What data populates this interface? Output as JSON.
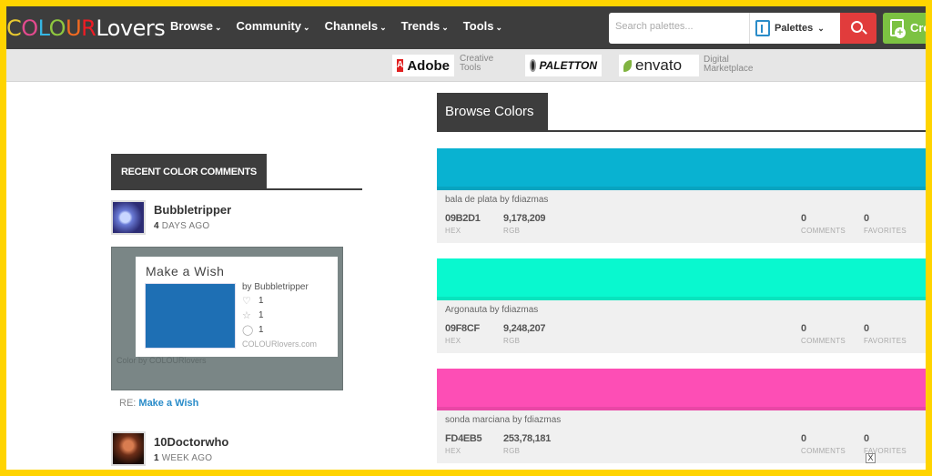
{
  "brand": {
    "logo_parts": [
      "C",
      "O",
      "L",
      "O",
      "U",
      "R"
    ],
    "logo_suffix": "Lovers"
  },
  "nav": {
    "items": [
      {
        "label": "Browse"
      },
      {
        "label": "Community"
      },
      {
        "label": "Channels"
      },
      {
        "label": "Trends"
      },
      {
        "label": "Tools"
      }
    ],
    "search_placeholder": "Search palettes...",
    "search_scope": "Palettes",
    "create_label": "Cre"
  },
  "sponsors": {
    "adobe": {
      "name": "Adobe",
      "mark": "A",
      "desc_line1": "Creative",
      "desc_line2": "Tools"
    },
    "paletton": {
      "name": "PALETTON"
    },
    "envato": {
      "name": "envato",
      "desc_line1": "Digital",
      "desc_line2": "Marketplace"
    }
  },
  "comments": {
    "heading": "RECENT COLOR COMMENTS",
    "items": [
      {
        "user": "Bubbletripper",
        "time_num": "4",
        "time_unit": "DAYS AGO"
      },
      {
        "user": "10Doctorwho",
        "time_num": "1",
        "time_unit": "WEEK AGO"
      }
    ],
    "card": {
      "title": "Make a Wish",
      "by": "by Bubbletripper",
      "swatch_color": "#1e6fb4",
      "loves": "1",
      "favorites": "1",
      "comments": "1",
      "site": "COLOURlovers.com",
      "credit": "Color by COLOURlovers"
    },
    "re_prefix": "RE:",
    "re_link": "Make a Wish"
  },
  "browse": {
    "heading": "Browse Colors",
    "hex_label": "HEX",
    "rgb_label": "RGB",
    "comments_label": "COMMENTS",
    "favorites_label": "FAVORITES",
    "colors": [
      {
        "name": "bala de plata",
        "by": "by fdiazmas",
        "hex": "09B2D1",
        "rgb": "9,178,209",
        "comments": "0",
        "favorites": "0",
        "color": "#09b2d1"
      },
      {
        "name": "Argonauta",
        "by": "by fdiazmas",
        "hex": "09F8CF",
        "rgb": "9,248,207",
        "comments": "0",
        "favorites": "0",
        "color": "#09f8cf"
      },
      {
        "name": "sonda marciana",
        "by": "by fdiazmas",
        "hex": "FD4EB5",
        "rgb": "253,78,181",
        "comments": "0",
        "favorites": "0",
        "color": "#fd4eb5"
      }
    ]
  },
  "close_mark": "X"
}
